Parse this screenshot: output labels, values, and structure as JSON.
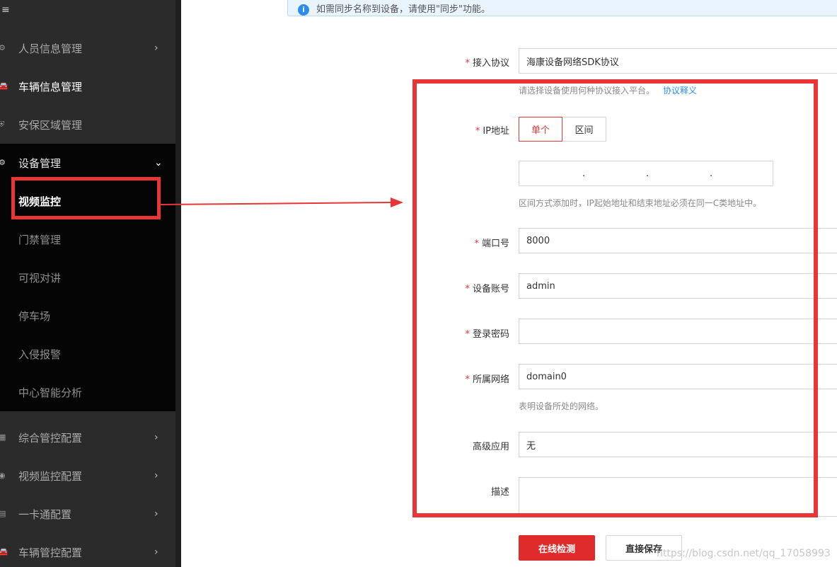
{
  "sidebar": {
    "menu_icon": "≡",
    "items_top": [
      {
        "label": "人员信息管理",
        "icon": "gear-person-icon",
        "has_chevron": true
      },
      {
        "label": "车辆信息管理",
        "icon": "car-icon",
        "has_chevron": false
      },
      {
        "label": "安保区域管理",
        "icon": "shield-icon",
        "has_chevron": false
      },
      {
        "label": "设备管理",
        "icon": "gear-icon",
        "has_chevron": true
      }
    ],
    "sub_items": [
      {
        "label": "视频监控"
      },
      {
        "label": "门禁管理"
      },
      {
        "label": "可视对讲"
      },
      {
        "label": "停车场"
      },
      {
        "label": "入侵报警"
      },
      {
        "label": "中心智能分析"
      }
    ],
    "items_bottom": [
      {
        "label": "综合管控配置",
        "icon": "grid-icon"
      },
      {
        "label": "视频监控配置",
        "icon": "camera-icon"
      },
      {
        "label": "一卡通配置",
        "icon": "card-icon"
      },
      {
        "label": "车辆管控配置",
        "icon": "car-icon"
      }
    ]
  },
  "info_bar": {
    "text": "如需同步名称到设备，请使用\"同步\"功能。"
  },
  "form": {
    "protocol": {
      "label": "接入协议",
      "value": "海康设备网络SDK协议",
      "hint": "请选择设备使用何种协议接入平台。",
      "hint_link": "协议释义"
    },
    "ip": {
      "label": "IP地址",
      "mode_single": "单个",
      "mode_range": "区间",
      "hint": "区间方式添加时，IP起始地址和结束地址必须在同一C类地址中。"
    },
    "port": {
      "label": "端口号",
      "value": "8000"
    },
    "account": {
      "label": "设备账号",
      "value": "admin"
    },
    "password": {
      "label": "登录密码",
      "value": ""
    },
    "network": {
      "label": "所属网络",
      "value": "domain0",
      "hint": "表明设备所处的网络。"
    },
    "advanced": {
      "label": "高级应用",
      "value": "无"
    },
    "description": {
      "label": "描述",
      "value": ""
    }
  },
  "buttons": {
    "check": "在线检测",
    "save": "直接保存"
  },
  "watermark": "https://blog.csdn.net/qq_17058993",
  "colors": {
    "accent": "#e02b2b",
    "sidebar_bg": "#2b2b2b",
    "submenu_bg": "#050505",
    "annotation": "#e83535"
  }
}
